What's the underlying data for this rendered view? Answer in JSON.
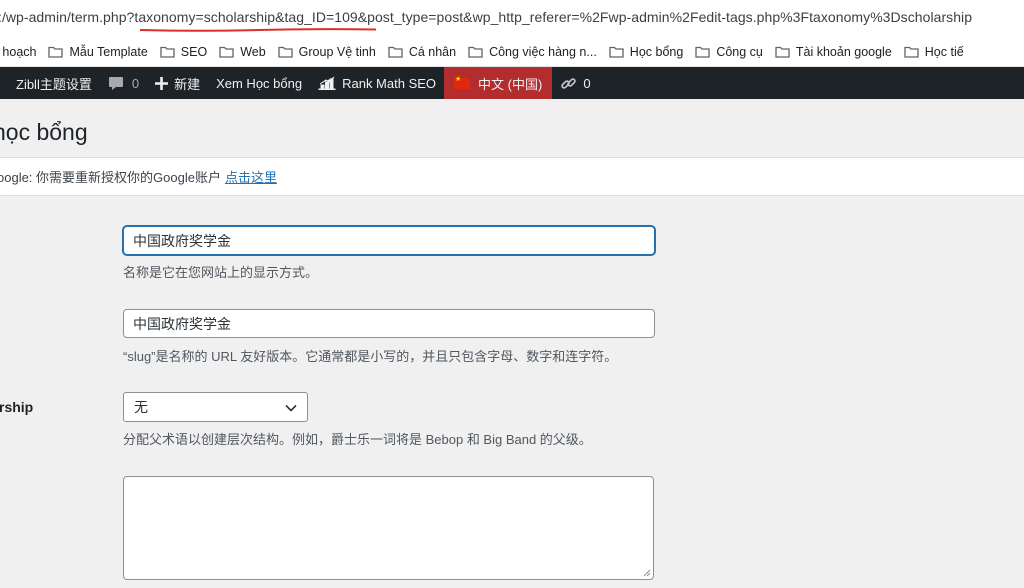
{
  "browser": {
    "url": ":/wp-admin/term.php?taxonomy=scholarship&tag_ID=109&post_type=post&wp_http_referer=%2Fwp-admin%2Fedit-tags.php%3Ftaxonomy%3Dscholarship",
    "bookmarks": [
      {
        "label": "ế hoạch"
      },
      {
        "label": "Mẫu Template"
      },
      {
        "label": "SEO"
      },
      {
        "label": "Web"
      },
      {
        "label": "Group Vệ tinh"
      },
      {
        "label": "Cá nhân"
      },
      {
        "label": "Công việc hàng n..."
      },
      {
        "label": "Học bổng"
      },
      {
        "label": "Công cụ"
      },
      {
        "label": "Tài khoản google"
      },
      {
        "label": "Học tiế"
      }
    ],
    "annotation_color": "#d93025"
  },
  "adminbar": {
    "theme_settings": "Zibll主题设置",
    "comments_count": "0",
    "new_label": "新建",
    "view_label": "Xem Học bổng",
    "rankmath_label": "Rank Math SEO",
    "language_label": "中文 (中国)",
    "links_count": "0",
    "bg_color": "#1d2327",
    "lang_bg_color": "#b32d2e"
  },
  "page": {
    "title": "học bổng"
  },
  "notice": {
    "text": "oogle: 你需要重新授权你的Google账户",
    "link": "点击这里"
  },
  "form": {
    "name_value": "中国政府奖学金",
    "name_desc": "名称是它在您网站上的显示方式。",
    "slug_value": "中国政府奖学金",
    "slug_desc": "“slug”是名称的 URL 友好版本。它通常都是小写的，并且只包含字母、数字和连字符。",
    "parent_label": "rship",
    "parent_selected": "无",
    "parent_desc": "分配父术语以创建层次结构。例如，爵士乐一词将是 Bebop 和 Big Band 的父级。",
    "description_value": ""
  }
}
